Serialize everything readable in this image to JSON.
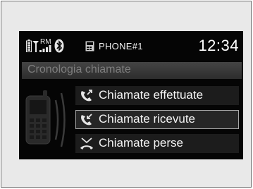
{
  "status_bar": {
    "phone_label": "PHONE#1",
    "roaming_indicator": "RM",
    "clock": "12:34",
    "icons": [
      "battery-icon",
      "signal-strength-icon",
      "bluetooth-icon",
      "phone-card-icon"
    ]
  },
  "screen": {
    "title": "Cronologia chiamate"
  },
  "menu": {
    "items": [
      {
        "label": "Chiamate effettuate",
        "icon": "outgoing-call-icon",
        "selected": false
      },
      {
        "label": "Chiamate ricevute",
        "icon": "incoming-call-icon",
        "selected": true
      },
      {
        "label": "Chiamate perse",
        "icon": "missed-call-icon",
        "selected": false
      }
    ]
  },
  "colors": {
    "screen_background": "#050505",
    "text": "#f4f4f4",
    "title_text": "#7e7e7e",
    "selection_border": "#a8a8a8"
  }
}
